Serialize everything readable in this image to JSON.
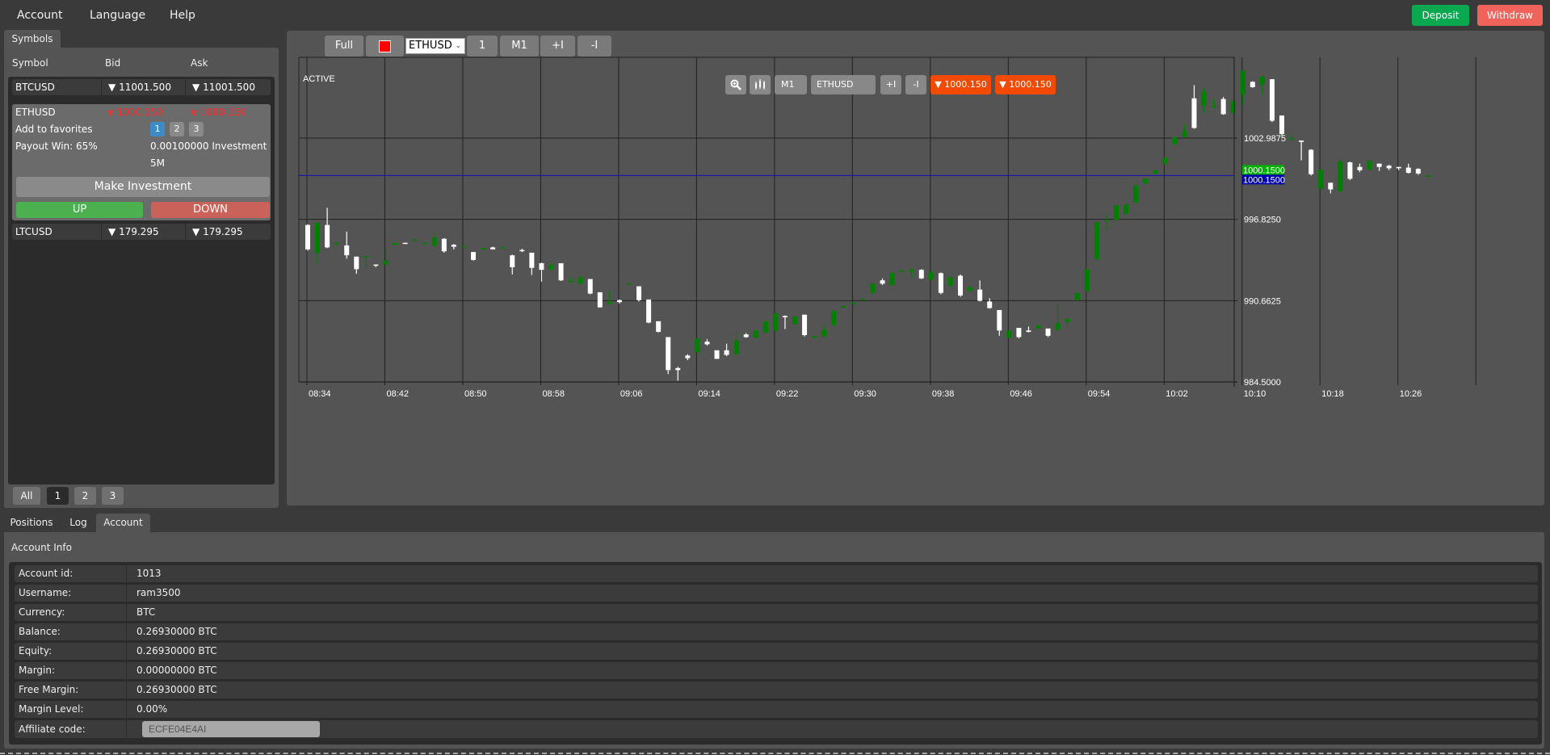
{
  "menu": {
    "items": [
      "Account",
      "Language",
      "Help"
    ],
    "deposit_label": "Deposit",
    "withdraw_label": "Withdraw"
  },
  "symbols": {
    "tab_label": "Symbols",
    "headers": {
      "symbol": "Symbol",
      "bid": "Bid",
      "ask": "Ask"
    },
    "rows": [
      {
        "symbol": "BTCUSD",
        "bid": "11001.500",
        "ask": "11001.500",
        "direction": "down"
      },
      {
        "symbol": "ETHUSD",
        "bid": "1000.150",
        "ask": "1000.150",
        "direction": "down"
      },
      {
        "symbol": "LTCUSD",
        "bid": "179.295",
        "ask": "179.295",
        "direction": "down"
      }
    ],
    "expanded": {
      "add_favorites_label": "Add to favorites",
      "fav_buttons": [
        "1",
        "2",
        "3"
      ],
      "fav_active": "1",
      "payout_label": "Payout Win: 65%",
      "investment_text": "0.00100000 Investment",
      "duration": "5M",
      "make_investment_label": "Make Investment",
      "up_label": "UP",
      "down_label": "DOWN"
    },
    "fav_tabs": [
      "All",
      "1",
      "2",
      "3"
    ],
    "fav_tab_active": "1"
  },
  "chart_toolbar": {
    "full_label": "Full",
    "color_value": "#ff0000",
    "symbol_select": "ETHUSD",
    "btn_1": "1",
    "timeframe": "M1",
    "plus_label": "+I",
    "minus_label": "-I"
  },
  "chart_inner_toolbar": {
    "zoom_icon": "zoom-in-icon",
    "candles_icon": "candlestick-icon",
    "timeframe": "M1",
    "symbol": "ETHUSD",
    "plus_label": "+I",
    "minus_label": "-I",
    "bid_label": "▼ 1000.150",
    "ask_label": "▼ 1000.150"
  },
  "colors": {
    "deposit": "#0aa84f",
    "withdraw": "#f0635a",
    "up": "#4caf50",
    "down": "#c9635a",
    "bull_candle": "#008000",
    "bear_candle": "#ffffff",
    "price_tag_green": "#00b000",
    "price_tag_blue": "#0000aa",
    "inner_price_btn": "#f24a00"
  },
  "chart_data": {
    "type": "candlestick",
    "status_label": "ACTIVE",
    "symbol": "ETHUSD",
    "timeframe": "M1",
    "ylim": [
      984.5,
      1002.9875
    ],
    "grid": true,
    "y_ticks": [
      "1002.9875",
      "996.8250",
      "990.6625",
      "984.5000"
    ],
    "y_tick_values": [
      1002.9875,
      996.825,
      990.6625,
      984.5
    ],
    "x_ticks": [
      "08:34",
      "08:42",
      "08:50",
      "08:58",
      "09:06",
      "09:14",
      "09:22",
      "09:30",
      "09:38",
      "09:46",
      "09:54",
      "10:02",
      "10:10",
      "10:18",
      "10:26"
    ],
    "current_price": 1000.15,
    "current_price_labels": [
      "1000.1500",
      "1000.1500"
    ],
    "candles": [
      {
        "o": 996.4,
        "h": 996.45,
        "c": 994.55,
        "l": 994.45
      },
      {
        "o": 994.3,
        "h": 996.6,
        "c": 996.55,
        "l": 993.35
      },
      {
        "o": 996.4,
        "h": 997.7,
        "c": 994.7,
        "l": 994.65
      },
      {
        "o": 995.0,
        "h": 995.1,
        "c": 995.05,
        "l": 994.85
      },
      {
        "o": 994.85,
        "h": 995.9,
        "c": 994.1,
        "l": 993.85
      },
      {
        "o": 994.0,
        "h": 994.0,
        "c": 993.05,
        "l": 992.7
      },
      {
        "o": 994.0,
        "h": 994.1,
        "c": 994.05,
        "l": 993.15
      },
      {
        "o": 993.4,
        "h": 993.4,
        "c": 993.35,
        "l": 993.2
      },
      {
        "o": 993.4,
        "h": 994.6,
        "c": 993.7,
        "l": 993.4
      },
      {
        "o": 994.9,
        "h": 995.1,
        "c": 995.05,
        "l": 994.9
      },
      {
        "o": 995.05,
        "h": 995.05,
        "c": 995.0,
        "l": 995.0
      },
      {
        "o": 995.3,
        "h": 995.35,
        "c": 995.3,
        "l": 995.25
      },
      {
        "o": 995.05,
        "h": 995.1,
        "c": 995.05,
        "l": 995.0
      },
      {
        "o": 994.8,
        "h": 995.85,
        "c": 995.45,
        "l": 994.75
      },
      {
        "o": 995.35,
        "h": 995.4,
        "c": 994.4,
        "l": 994.3
      },
      {
        "o": 994.9,
        "h": 994.95,
        "c": 994.75,
        "l": 994.55
      },
      {
        "o": 994.8,
        "h": 994.8,
        "c": 994.8,
        "l": 994.75
      },
      {
        "o": 994.35,
        "h": 994.35,
        "c": 993.75,
        "l": 993.7
      },
      {
        "o": 994.65,
        "h": 994.7,
        "c": 994.65,
        "l": 994.5
      },
      {
        "o": 994.7,
        "h": 994.75,
        "c": 994.55,
        "l": 994.55
      },
      {
        "o": 994.7,
        "h": 994.75,
        "c": 994.7,
        "l": 994.65
      },
      {
        "o": 994.1,
        "h": 994.15,
        "c": 993.2,
        "l": 992.65
      },
      {
        "o": 994.5,
        "h": 994.6,
        "c": 994.45,
        "l": 994.35
      },
      {
        "o": 994.3,
        "h": 994.3,
        "c": 993.15,
        "l": 992.6
      },
      {
        "o": 993.5,
        "h": 993.55,
        "c": 993.0,
        "l": 992.1
      },
      {
        "o": 993.05,
        "h": 993.5,
        "c": 993.35,
        "l": 992.95
      },
      {
        "o": 993.5,
        "h": 993.5,
        "c": 992.2,
        "l": 992.15
      },
      {
        "o": 992.15,
        "h": 992.45,
        "c": 992.15,
        "l": 992.0
      },
      {
        "o": 991.95,
        "h": 992.4,
        "c": 992.45,
        "l": 991.95
      },
      {
        "o": 992.3,
        "h": 992.3,
        "c": 991.2,
        "l": 991.15
      },
      {
        "o": 991.3,
        "h": 991.3,
        "c": 990.15,
        "l": 990.15
      },
      {
        "o": 990.4,
        "h": 991.45,
        "c": 990.55,
        "l": 990.4
      },
      {
        "o": 990.7,
        "h": 990.75,
        "c": 990.55,
        "l": 990.45
      },
      {
        "o": 991.95,
        "h": 992.05,
        "c": 991.95,
        "l": 991.85
      },
      {
        "o": 991.75,
        "h": 991.75,
        "c": 990.7,
        "l": 990.6
      },
      {
        "o": 990.75,
        "h": 990.75,
        "c": 989.0,
        "l": 988.95
      },
      {
        "o": 989.1,
        "h": 989.1,
        "c": 988.3,
        "l": 988.25
      },
      {
        "o": 987.9,
        "h": 987.9,
        "c": 985.4,
        "l": 985.1
      },
      {
        "o": 985.55,
        "h": 985.65,
        "c": 985.4,
        "l": 984.6
      },
      {
        "o": 986.5,
        "h": 986.6,
        "c": 986.3,
        "l": 986.15
      },
      {
        "o": 986.75,
        "h": 986.75,
        "c": 987.8,
        "l": 986.7
      },
      {
        "o": 987.55,
        "h": 987.75,
        "c": 987.35,
        "l": 987.25
      },
      {
        "o": 986.9,
        "h": 986.9,
        "c": 986.25,
        "l": 986.25
      },
      {
        "o": 986.9,
        "h": 987.4,
        "c": 986.55,
        "l": 986.45
      },
      {
        "o": 986.6,
        "h": 988.3,
        "c": 987.65,
        "l": 986.6
      },
      {
        "o": 988.1,
        "h": 988.2,
        "c": 987.9,
        "l": 987.85
      },
      {
        "o": 987.85,
        "h": 988.45,
        "c": 988.4,
        "l": 987.85
      },
      {
        "o": 988.25,
        "h": 989.15,
        "c": 989.1,
        "l": 988.2
      },
      {
        "o": 988.4,
        "h": 989.7,
        "c": 989.7,
        "l": 988.3
      },
      {
        "o": 989.5,
        "h": 989.55,
        "c": 989.4,
        "l": 988.5
      },
      {
        "o": 988.9,
        "h": 989.5,
        "c": 989.45,
        "l": 988.85
      },
      {
        "o": 989.6,
        "h": 989.6,
        "c": 988.05,
        "l": 987.95
      },
      {
        "o": 987.9,
        "h": 988.0,
        "c": 987.95,
        "l": 987.8
      },
      {
        "o": 987.95,
        "h": 988.75,
        "c": 988.45,
        "l": 987.9
      },
      {
        "o": 988.8,
        "h": 989.9,
        "c": 989.9,
        "l": 988.75
      },
      {
        "o": 990.15,
        "h": 990.3,
        "c": 990.25,
        "l": 990.1
      },
      {
        "o": 990.4,
        "h": 990.55,
        "c": 990.5,
        "l": 990.4
      },
      {
        "o": 990.7,
        "h": 990.85,
        "c": 990.8,
        "l": 990.7
      },
      {
        "o": 991.25,
        "h": 991.4,
        "c": 991.95,
        "l": 991.2
      },
      {
        "o": 992.2,
        "h": 992.35,
        "c": 991.95,
        "l": 991.85
      },
      {
        "o": 991.85,
        "h": 992.8,
        "c": 992.75,
        "l": 991.8
      },
      {
        "o": 992.85,
        "h": 992.95,
        "c": 992.95,
        "l": 992.85
      },
      {
        "o": 992.9,
        "h": 992.95,
        "c": 993.05,
        "l": 992.4
      },
      {
        "o": 993.0,
        "h": 993.05,
        "c": 992.35,
        "l": 992.3
      },
      {
        "o": 992.25,
        "h": 993.05,
        "c": 992.8,
        "l": 992.2
      },
      {
        "o": 992.75,
        "h": 992.8,
        "c": 991.25,
        "l": 991.15
      },
      {
        "o": 991.8,
        "h": 991.8,
        "c": 992.45,
        "l": 991.75
      },
      {
        "o": 992.55,
        "h": 992.65,
        "c": 991.05,
        "l": 990.95
      },
      {
        "o": 991.4,
        "h": 991.4,
        "c": 991.7,
        "l": 991.35
      },
      {
        "o": 991.5,
        "h": 992.2,
        "c": 990.65,
        "l": 990.6
      },
      {
        "o": 990.6,
        "h": 990.85,
        "c": 990.1,
        "l": 990.05
      },
      {
        "o": 989.95,
        "h": 989.95,
        "c": 988.4,
        "l": 988.0
      },
      {
        "o": 987.85,
        "h": 988.4,
        "c": 988.4,
        "l": 987.8
      },
      {
        "o": 988.6,
        "h": 988.6,
        "c": 987.9,
        "l": 987.8
      },
      {
        "o": 988.4,
        "h": 988.7,
        "c": 988.3,
        "l": 988.25
      },
      {
        "o": 988.55,
        "h": 988.55,
        "c": 988.8,
        "l": 988.55
      },
      {
        "o": 988.55,
        "h": 988.55,
        "c": 988.0,
        "l": 987.9
      },
      {
        "o": 988.45,
        "h": 990.4,
        "c": 988.95,
        "l": 988.4
      },
      {
        "o": 989.05,
        "h": 989.05,
        "c": 989.3,
        "l": 988.7
      },
      {
        "o": 990.7,
        "h": 990.7,
        "c": 991.25,
        "l": 990.65
      },
      {
        "o": 991.4,
        "h": 991.4,
        "c": 993.05,
        "l": 991.35
      },
      {
        "o": 993.8,
        "h": 993.8,
        "c": 996.6,
        "l": 993.75
      },
      {
        "o": 996.8,
        "h": 997.15,
        "c": 996.8,
        "l": 996.0
      },
      {
        "o": 996.8,
        "h": 996.8,
        "c": 997.9,
        "l": 996.75
      },
      {
        "o": 997.25,
        "h": 997.3,
        "c": 997.95,
        "l": 997.2
      },
      {
        "o": 998.1,
        "h": 998.1,
        "c": 999.4,
        "l": 998.05
      },
      {
        "o": 999.55,
        "h": 999.55,
        "c": 999.9,
        "l": 999.5
      },
      {
        "o": 1000.3,
        "h": 1000.35,
        "c": 1000.55,
        "l": 1000.25
      },
      {
        "o": 1001.05,
        "h": 1001.1,
        "c": 1001.5,
        "l": 1001.0
      },
      {
        "o": 1002.55,
        "h": 1002.55,
        "c": 1003.05,
        "l": 1002.45
      },
      {
        "o": 1003.1,
        "h": 1004.0,
        "c": 1003.5,
        "l": 1003.0
      },
      {
        "o": 1006.0,
        "h": 1007.0,
        "c": 1003.75,
        "l": 1003.7
      },
      {
        "o": 1005.45,
        "h": 1006.8,
        "c": 1006.5,
        "l": 1004.9
      },
      {
        "o": 1005.4,
        "h": 1005.9,
        "c": 1005.4,
        "l": 1005.25
      },
      {
        "o": 1005.95,
        "h": 1006.1,
        "c": 1004.8,
        "l": 1004.75
      },
      {
        "o": 1004.9,
        "h": 1004.9,
        "c": 1005.8,
        "l": 1004.85
      },
      {
        "o": 1006.3,
        "h": 1006.35,
        "c": 1008.1,
        "l": 1005.5
      },
      {
        "o": 1007.25,
        "h": 1007.3,
        "c": 1006.85,
        "l": 1006.8
      },
      {
        "o": 1007.05,
        "h": 1007.05,
        "c": 1007.65,
        "l": 1006.25
      },
      {
        "o": 1007.45,
        "h": 1007.45,
        "c": 1004.3,
        "l": 1004.2
      },
      {
        "o": 1004.7,
        "h": 1004.7,
        "c": 1003.3,
        "l": 1003.2
      },
      {
        "o": 1002.95,
        "h": 1003.25,
        "c": 1002.95,
        "l": 1002.85
      },
      {
        "o": 1002.8,
        "h": 1002.8,
        "c": 1002.7,
        "l": 1001.3
      },
      {
        "o": 1002.1,
        "h": 1002.15,
        "c": 1000.25,
        "l": 1000.15
      },
      {
        "o": 999.15,
        "h": 999.15,
        "c": 1000.6,
        "l": 999.1
      },
      {
        "o": 999.6,
        "h": 999.6,
        "c": 999.1,
        "l": 998.8
      },
      {
        "o": 998.95,
        "h": 1001.45,
        "c": 1001.2,
        "l": 998.95
      },
      {
        "o": 1001.15,
        "h": 1001.2,
        "c": 999.9,
        "l": 999.8
      },
      {
        "o": 1000.8,
        "h": 1001.05,
        "c": 1000.55,
        "l": 1000.4
      },
      {
        "o": 1000.6,
        "h": 1001.3,
        "c": 1001.25,
        "l": 1000.55
      },
      {
        "o": 1001.05,
        "h": 1001.05,
        "c": 1000.8,
        "l": 1000.5
      },
      {
        "o": 1000.9,
        "h": 1000.95,
        "c": 1000.7,
        "l": 1000.55
      },
      {
        "o": 1000.8,
        "h": 1000.8,
        "c": 1000.7,
        "l": 1000.55
      },
      {
        "o": 1000.75,
        "h": 1001.05,
        "c": 1000.35,
        "l": 1000.3
      },
      {
        "o": 1000.65,
        "h": 1000.7,
        "c": 1000.3,
        "l": 1000.2
      },
      {
        "o": 1000.15,
        "h": 1000.2,
        "c": 1000.15,
        "l": 1000.15
      }
    ]
  },
  "bottom_tabs": {
    "items": [
      "Positions",
      "Log",
      "Account"
    ],
    "active": "Account"
  },
  "account_info": {
    "title": "Account Info",
    "rows": [
      {
        "label": "Account id:",
        "value": "1013"
      },
      {
        "label": "Username:",
        "value": "ram3500"
      },
      {
        "label": "Currency:",
        "value": "BTC"
      },
      {
        "label": "Balance:",
        "value": "0.26930000 BTC"
      },
      {
        "label": "Equity:",
        "value": "0.26930000 BTC"
      },
      {
        "label": "Margin:",
        "value": "0.00000000 BTC"
      },
      {
        "label": "Free Margin:",
        "value": "0.26930000 BTC"
      },
      {
        "label": "Margin Level:",
        "value": "0.00%"
      }
    ],
    "affiliate_label": "Affiliate code:",
    "affiliate_code": "ECFE04E4AI"
  }
}
